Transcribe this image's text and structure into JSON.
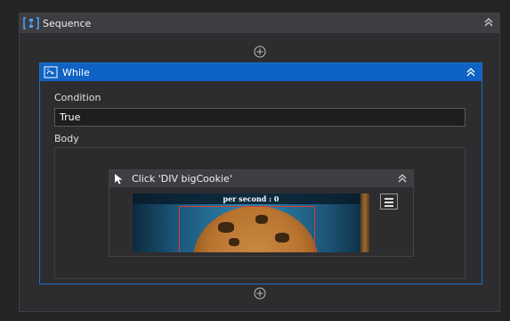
{
  "sequence": {
    "title": "Sequence",
    "icon": "sequence-icon"
  },
  "while": {
    "title": "While",
    "icon": "while-loop-icon",
    "condition_label": "Condition",
    "condition_value": "True",
    "body_label": "Body"
  },
  "click_activity": {
    "title": "Click 'DIV  bigCookie'",
    "icon": "cursor-icon",
    "screenshot_text": "per second : 0"
  },
  "colors": {
    "while_accent": "#0e63c4",
    "highlight_box": "#d83a3a"
  }
}
